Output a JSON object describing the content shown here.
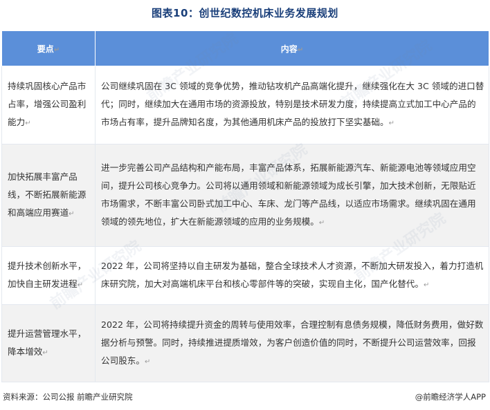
{
  "title": "图表10：创世纪数控机床业务发展规划",
  "table": {
    "header": {
      "col1": "要点",
      "col2": "内容"
    },
    "rows": [
      {
        "key": "持续巩固核心产品市占率，增强公司盈利能力",
        "content": "公司继续巩固在 3C 领域的竞争优势，推动钻攻机产品高端化提升，继续强化在大 3C 领域的进口替代；同时，继续加大在通用市场的资源投放，特别是技术研发力度，持续提高立式加工中心产品的市场占有率，提升品牌知名度，为其他通用机床产品的投放打下坚实基础。"
      },
      {
        "key": "加快拓展丰富产品线，不断拓展新能源和高端应用赛道",
        "content": "进一步完善公司产品结构和产能布局，丰富产品体系，拓展新能源汽车、新能源电池等领域应用空间，提升公司核心竞争力。公司将以通用领域和新能源领域为成长引擎，加大技术创新，无限贴近市场需求，不断丰富公司卧式加工中心、车床、龙门等产品线，以适应市场需求。继续巩固在通用领域的领先地位，扩大在新能源领域的应用的业务规模。"
      },
      {
        "key": "提升技术创新水平，加快自主研发进程",
        "content": "2022 年，公司将坚持以自主研发为基础，整合全球技术人才资源，不断加大研发投入，着力打造机床研究院，加大对高端机床平台和核心零部件等的突破，实现自主化，国产化替代。"
      },
      {
        "key": "提升运营管理水平，降本增效",
        "content": "2022 年，公司将持续提升资金的周转与使用效率，合理控制有息债务规模，降低财务费用，做好数据分析与预警。同时，持续推进提质增效，为客户创造价值的同时，不断提升公司运营效率，回报公司股东。"
      }
    ]
  },
  "watermark_text": "前瞻产业研究院",
  "footer": {
    "source": "资料来源：公司公报 前瞻产业研究院",
    "brand": "@前瞻经济学人APP"
  }
}
